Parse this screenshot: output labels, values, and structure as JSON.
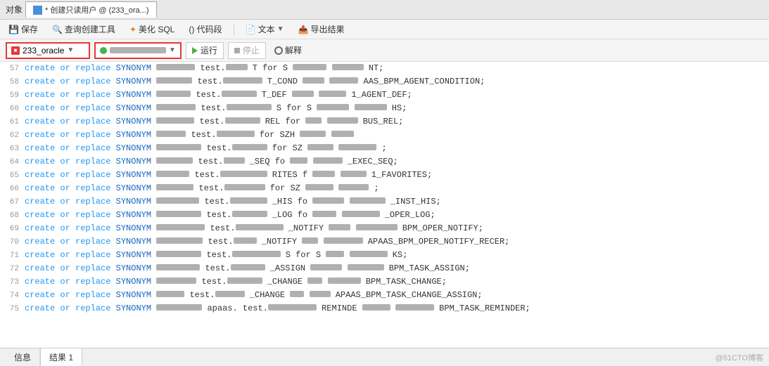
{
  "titleBar": {
    "label": "对象",
    "tab": "* 创建只读用户 @         (233_ora...)"
  },
  "toolbar": {
    "save": "保存",
    "queryTool": "查询创建工具",
    "beautifySql": "美化 SQL",
    "codeBlock": "() 代码段",
    "text": "文本",
    "exportResult": "导出结果"
  },
  "connBar": {
    "dbName": "233_oracle",
    "schema": "",
    "runBtn": "运行",
    "stopBtn": "停止",
    "explainBtn": "解释"
  },
  "codeLines": [
    {
      "num": "57",
      "content": "create or replace SYNONYM",
      "suffix": "test.",
      "end": "T for S",
      "tail": "NT;"
    },
    {
      "num": "58",
      "content": "create or replace SYNONYM",
      "suffix": "test.",
      "end": "T_COND",
      "tail": "AAS_BPM_AGENT_CONDITION;"
    },
    {
      "num": "59",
      "content": "create or replace SYNONYM",
      "suffix": "test.",
      "end": "T_DEF",
      "tail": "1_AGENT_DEF;"
    },
    {
      "num": "60",
      "content": "create or replace SYNONYM",
      "suffix": "test.",
      "end": "S for S",
      "tail": "HS;"
    },
    {
      "num": "61",
      "content": "create or replace SYNONYM",
      "suffix": "test.",
      "end": "REL for",
      "tail": "BUS_REL;"
    },
    {
      "num": "62",
      "content": "create or replace SYNONYM",
      "suffix": "test.",
      "end": "for SZH",
      "tail": ""
    },
    {
      "num": "63",
      "content": "create or replace SYNONYM",
      "suffix": "test.",
      "end": "for SZ",
      "tail": ";"
    },
    {
      "num": "64",
      "content": "create or replace SYNONYM",
      "suffix": "test.",
      "end": "_SEQ fo",
      "tail": "_EXEC_SEQ;"
    },
    {
      "num": "65",
      "content": "create or replace SYNONYM",
      "suffix": "test.",
      "end": "RITES f",
      "tail": "1_FAVORITES;"
    },
    {
      "num": "66",
      "content": "create or replace SYNONYM",
      "suffix": "test.",
      "end": "for SZ",
      "tail": ";"
    },
    {
      "num": "67",
      "content": "create or replace SYNONYM",
      "suffix": "test.",
      "end": "_HIS fo",
      "tail": "_INST_HIS;"
    },
    {
      "num": "68",
      "content": "create or replace SYNONYM",
      "suffix": "test.",
      "end": "_LOG fo",
      "tail": "_OPER_LOG;"
    },
    {
      "num": "69",
      "content": "create or replace SYNONYM",
      "suffix": "test.",
      "end": "_NOTIFY",
      "tail": "BPM_OPER_NOTIFY;"
    },
    {
      "num": "70",
      "content": "create or replace SYNONYM",
      "suffix": "test.",
      "end": "_NOTIFY",
      "tail": "APAAS_BPM_OPER_NOTIFY_RECER;"
    },
    {
      "num": "71",
      "content": "create or replace SYNONYM",
      "suffix": "test.",
      "end": "S for S",
      "tail": "KS;"
    },
    {
      "num": "72",
      "content": "create or replace SYNONYM",
      "suffix": "test.",
      "end": "_ASSIGN",
      "tail": "BPM_TASK_ASSIGN;"
    },
    {
      "num": "73",
      "content": "create or replace SYNONYM",
      "suffix": "test.",
      "end": "_CHANGE",
      "tail": "BPM_TASK_CHANGE;"
    },
    {
      "num": "74",
      "content": "create or replace SYNONYM",
      "suffix": "test.",
      "end": "_CHANGE",
      "tail": "APAAS_BPM_TASK_CHANGE_ASSIGN;"
    },
    {
      "num": "75",
      "content": "create or replace SYNONYM",
      "suffix": "apaas. test.",
      "end": "REMINDE",
      "tail": "BPM_TASK_REMINDER;"
    }
  ],
  "bottomTabs": [
    {
      "label": "信息",
      "active": false
    },
    {
      "label": "结果 1",
      "active": true
    }
  ],
  "watermark": "@51CTO博客"
}
